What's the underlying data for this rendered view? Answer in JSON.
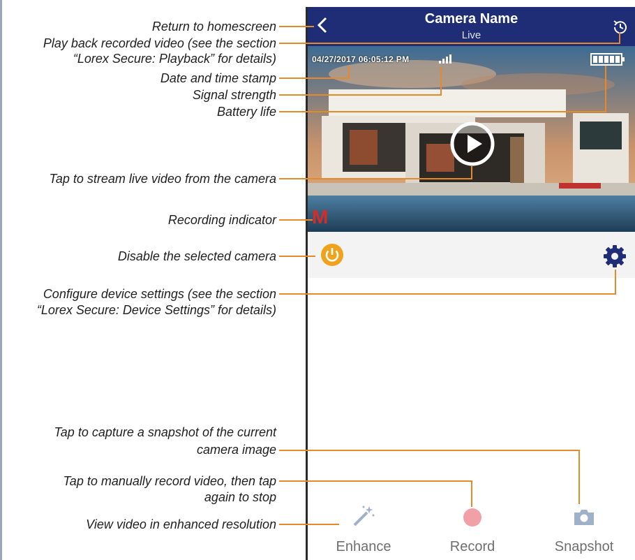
{
  "header": {
    "title": "Camera Name",
    "subtitle": "Live"
  },
  "video": {
    "timestamp": "04/27/2017 06:05:12 PM",
    "recording_indicator": "M"
  },
  "toolbar": [
    {
      "label": "Enhance",
      "icon": "magic-wand-icon"
    },
    {
      "label": "Record",
      "icon": "record-dot-icon"
    },
    {
      "label": "Snapshot",
      "icon": "camera-icon"
    }
  ],
  "annotations": {
    "return_home": "Return to homescreen",
    "playback_1": "Play back recorded video (see the section",
    "playback_2": "“Lorex Secure: Playback” for details)",
    "timestamp": "Date and time stamp",
    "signal": "Signal strength",
    "battery": "Battery life",
    "stream": "Tap to stream live video from the camera",
    "recording": "Recording indicator",
    "disable": "Disable the selected camera",
    "settings_1": "Configure device settings (see the section",
    "settings_2": "“Lorex Secure: Device Settings” for details)",
    "snapshot_1": "Tap to capture a snapshot of the current",
    "snapshot_2": "camera image",
    "record_1": "Tap to manually record video, then tap",
    "record_2": "again to stop",
    "enhance": "View video in enhanced resolution"
  },
  "colors": {
    "header": "#1f2d77",
    "callout": "#e58a2b",
    "power": "#f1a21b",
    "gear": "#1f2d77",
    "record": "#f2a0a8",
    "recording": "#d62b2b"
  }
}
